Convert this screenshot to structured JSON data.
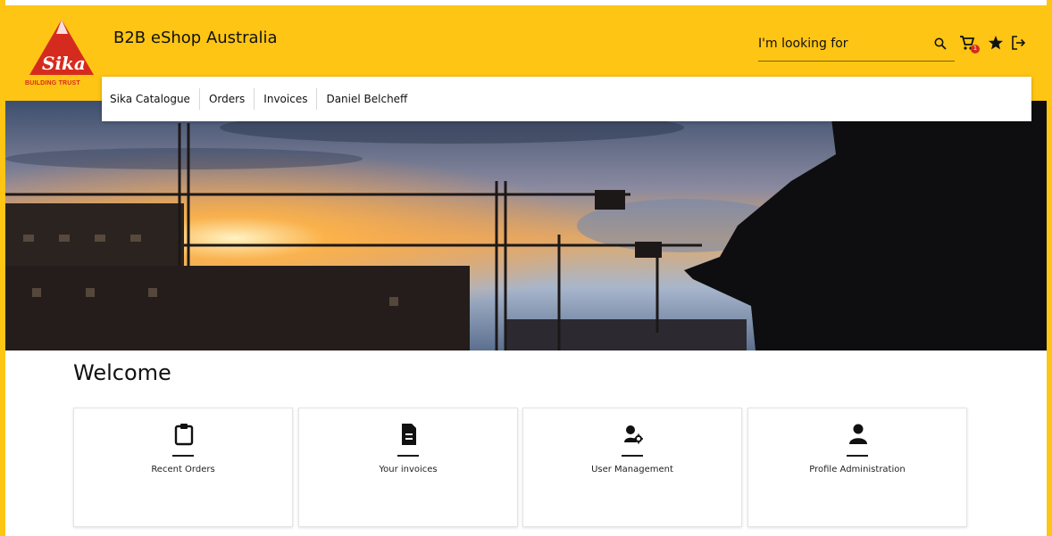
{
  "brand": {
    "logo_text": "Sika",
    "tagline": "BUILDING TRUST",
    "colors": {
      "primary_yellow": "#ffc514",
      "brand_red": "#d52b1e"
    }
  },
  "header": {
    "title": "B2B eShop Australia",
    "search_placeholder": "I'm looking for",
    "cart_count": "1",
    "icons": [
      "search-icon",
      "cart-icon",
      "favorites-star-icon",
      "logout-icon"
    ]
  },
  "nav": {
    "items": [
      {
        "label": "Sika Catalogue"
      },
      {
        "label": "Orders"
      },
      {
        "label": "Invoices"
      },
      {
        "label": "Daniel Belcheff"
      }
    ]
  },
  "main": {
    "welcome": "Welcome",
    "tiles": [
      {
        "label": "Recent Orders",
        "icon": "clipboard-icon"
      },
      {
        "label": "Your invoices",
        "icon": "document-icon"
      },
      {
        "label": "User Management",
        "icon": "user-settings-icon"
      },
      {
        "label": "Profile Administration",
        "icon": "person-icon"
      }
    ]
  }
}
